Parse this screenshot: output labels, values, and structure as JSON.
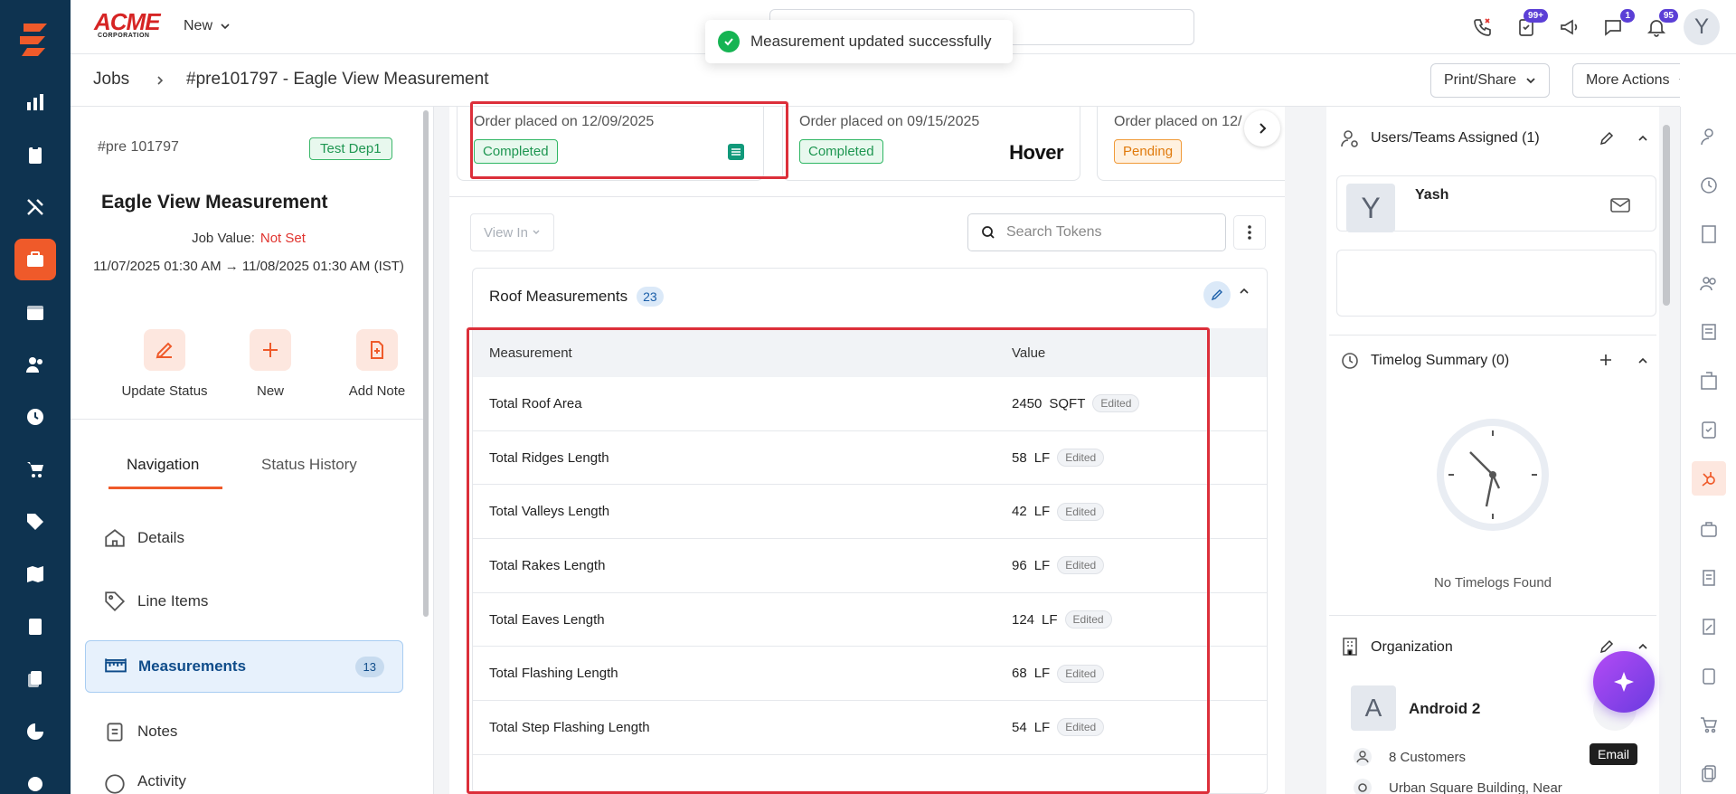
{
  "toast": {
    "message": "Measurement updated successfully"
  },
  "brand": {
    "name": "ACME",
    "sub": "CORPORATION"
  },
  "topbar": {
    "new_label": "New",
    "badges": {
      "tasks": "99+",
      "chat": "1",
      "notifications": "95"
    },
    "avatar_letter": "Y"
  },
  "breadcrumb": {
    "root": "Jobs",
    "current": "#pre101797 - Eagle View Measurement"
  },
  "header_actions": {
    "print_share": "Print/Share",
    "more_actions": "More Actions"
  },
  "job": {
    "id": "#pre 101797",
    "department": "Test Dep1",
    "title": "Eagle View Measurement",
    "value_label": "Job Value:",
    "value": "Not Set",
    "dates": "11/07/2025 01:30 AM → 11/08/2025 01:30 AM (IST)"
  },
  "quick_actions": {
    "update_status": "Update Status",
    "new": "New",
    "add_note": "Add Note"
  },
  "tabs": {
    "navigation": "Navigation",
    "status_history": "Status History"
  },
  "nav": {
    "details": "Details",
    "line_items": "Line Items",
    "measurements": "Measurements",
    "measurements_count": "13",
    "notes": "Notes",
    "activity": "Activity"
  },
  "orders": [
    {
      "label": "Order placed on 12/09/2025",
      "status": "Completed",
      "brand": ""
    },
    {
      "label": "Order placed on 09/15/2025",
      "status": "Completed",
      "brand": "Hover"
    },
    {
      "label": "Order placed on 12/",
      "status": "Pending",
      "brand": ""
    }
  ],
  "toolbar": {
    "view_in": "View In",
    "search_placeholder": "Search Tokens"
  },
  "measurements_section": {
    "title": "Roof Measurements",
    "count": "23",
    "col_measurement": "Measurement",
    "col_value": "Value",
    "edited_label": "Edited",
    "rows": [
      {
        "name": "Total Roof Area",
        "value": "2450",
        "unit": "SQFT"
      },
      {
        "name": "Total Ridges Length",
        "value": "58",
        "unit": "LF"
      },
      {
        "name": "Total Valleys Length",
        "value": "42",
        "unit": "LF"
      },
      {
        "name": "Total Rakes Length",
        "value": "96",
        "unit": "LF"
      },
      {
        "name": "Total Eaves Length",
        "value": "124",
        "unit": "LF"
      },
      {
        "name": "Total Flashing Length",
        "value": "68",
        "unit": "LF"
      },
      {
        "name": "Total Step Flashing Length",
        "value": "54",
        "unit": "LF"
      }
    ]
  },
  "right_panel": {
    "users_title": "Users/Teams Assigned (1)",
    "user_name": "Yash",
    "user_letter": "Y",
    "timelog_title": "Timelog Summary (0)",
    "no_timelogs": "No Timelogs Found",
    "org_title": "Organization",
    "org_letter": "A",
    "org_name": "Android 2",
    "org_customers": "8 Customers",
    "org_address": "Urban Square Building, Near",
    "email_tooltip": "Email"
  },
  "colors": {
    "accent": "#ef5a2a",
    "rail": "#0e3350",
    "highlight": "#dc2f3a",
    "ai": "#8a44ea"
  }
}
